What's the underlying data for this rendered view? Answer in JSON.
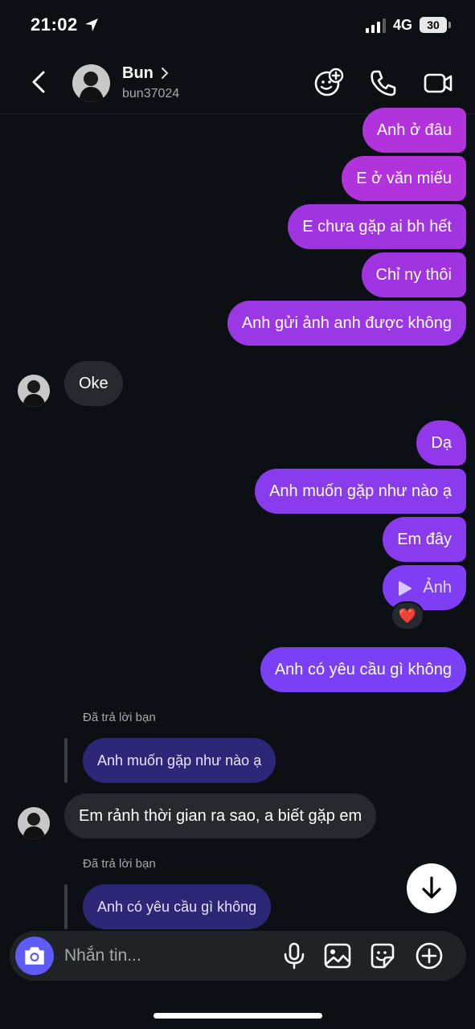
{
  "status_bar": {
    "time": "21:02",
    "network": "4G",
    "battery": "30"
  },
  "header": {
    "name": "Bun",
    "username": "bun37024"
  },
  "messages": [
    {
      "text": "Anh ở đâu"
    },
    {
      "text": "E ở văn miếu"
    },
    {
      "text": "E chưa gặp ai bh hết"
    },
    {
      "text": "Chỉ ny thôi"
    },
    {
      "text": "Anh gửi ảnh anh được không"
    },
    {
      "text": "Oke"
    },
    {
      "text": "Dạ"
    },
    {
      "text": "Anh muốn gặp như nào ạ"
    },
    {
      "text": "Em đây"
    },
    {
      "text": "Ảnh"
    },
    {
      "text": "Anh có yêu cầu gì không"
    },
    {
      "label": "Đã trả lời bạn",
      "quote": "Anh muốn gặp như nào ạ",
      "text": "Em rảnh thời gian ra sao, a biết gặp em"
    },
    {
      "label": "Đã trả lời bạn",
      "quote": "Anh có yêu cầu gì không"
    }
  ],
  "reaction": "❤️",
  "composer": {
    "placeholder": "Nhắn tin..."
  },
  "icons": [
    "location-arrow-icon",
    "signal-icon",
    "back-chevron-icon",
    "chevron-right-icon",
    "add-sticker-icon",
    "phone-icon",
    "video-camera-icon",
    "play-icon",
    "arrow-down-icon",
    "camera-icon",
    "microphone-icon",
    "image-icon",
    "sticker-icon",
    "plus-circle-icon"
  ],
  "colors": {
    "background": "#0c1014",
    "incoming": "#262a2f",
    "outgoing_top": "#b133dc",
    "outgoing_bottom": "#7a40f5",
    "reply_quote": "#2d2778",
    "camera_button": "#5f5bf6"
  }
}
